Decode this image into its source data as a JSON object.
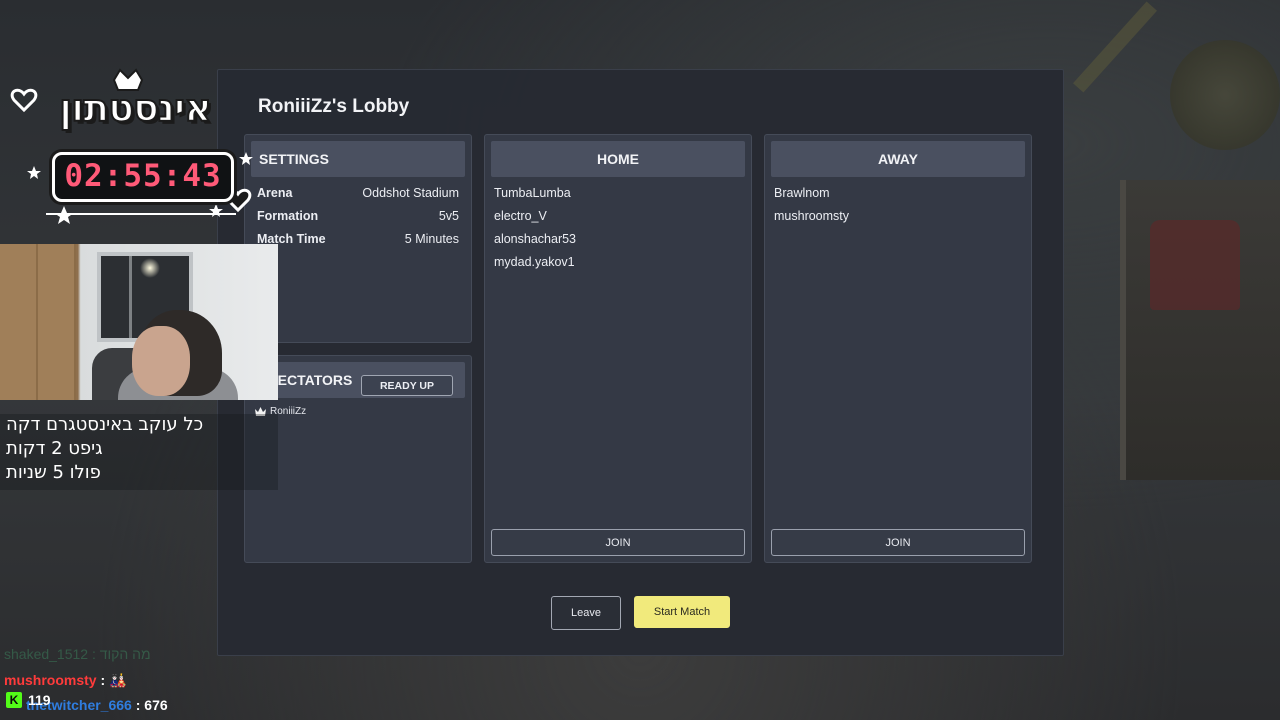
{
  "lobby": {
    "title": "RoniiiZz's Lobby",
    "settings": {
      "header": "SETTINGS",
      "rows": [
        {
          "label": "Arena",
          "value": "Oddshot Stadium"
        },
        {
          "label": "Formation",
          "value": "5v5"
        },
        {
          "label": "Match Time",
          "value": "5 Minutes"
        }
      ]
    },
    "spectators": {
      "header": "SPECTATORS",
      "ready_label": "READY UP",
      "entries": [
        "RoniiiZz"
      ]
    },
    "home": {
      "header": "HOME",
      "players": [
        "TumbaLumba",
        "electro_V",
        "alonshachar53",
        "mydad.yakov1"
      ],
      "join_label": "JOIN"
    },
    "away": {
      "header": "AWAY",
      "players": [
        "Brawlnom",
        "mushroomsty"
      ],
      "join_label": "JOIN"
    },
    "leave_label": "Leave",
    "start_label": "Start Match"
  },
  "overlay": {
    "logo_text": "אינסטתון",
    "timer": "02:55:43",
    "text_lines": [
      "כל עוקב באינסטגרם דקה",
      "גיפט 2 דקות",
      "פולו 5 שניות"
    ]
  },
  "chat": [
    {
      "user": "shaked_1512",
      "text": "מה הקוד",
      "style": "faded"
    },
    {
      "user": "mushroomsty",
      "text": "🎎",
      "style": "red"
    },
    {
      "user": "thetwitcher_666",
      "text": "676",
      "style": "blue"
    }
  ],
  "viewer_count": "119",
  "colors": {
    "accent": "#f1ea7c",
    "timer": "#ff5a78",
    "kick": "#53fc18"
  }
}
